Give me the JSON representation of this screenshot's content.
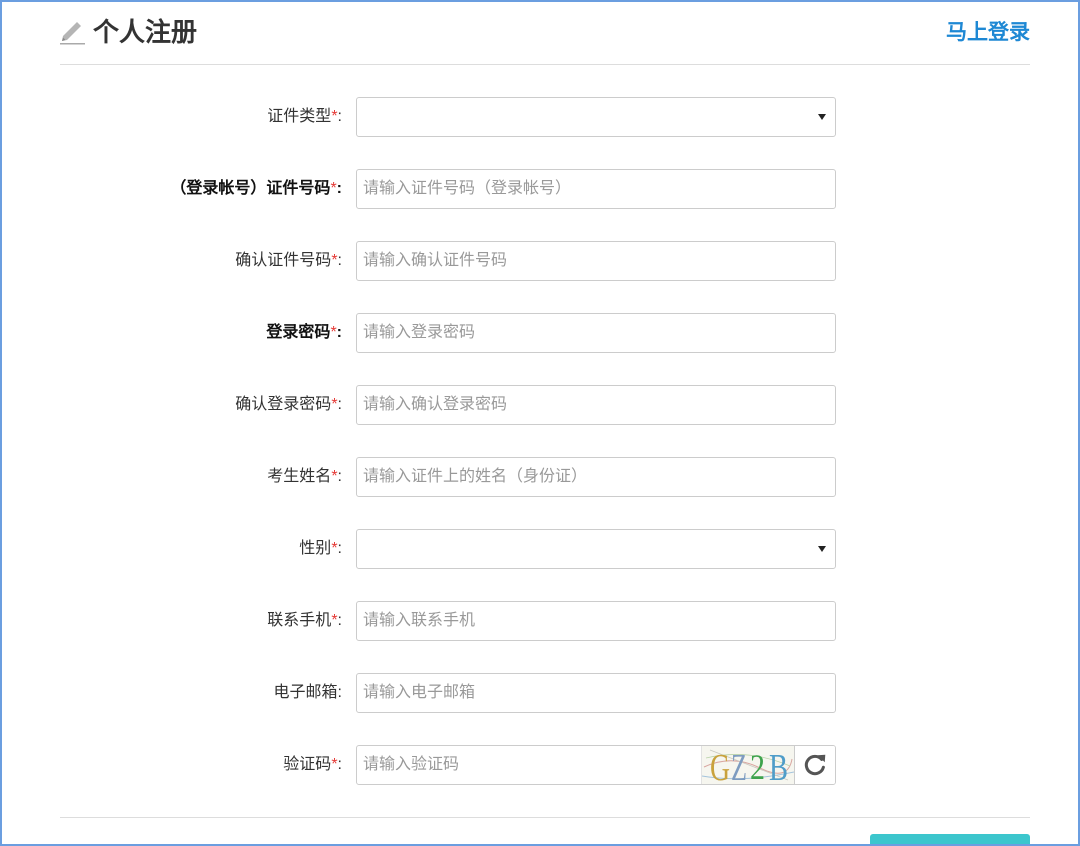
{
  "header": {
    "title": "个人注册",
    "login_link": "马上登录"
  },
  "form": {
    "colon": ":",
    "fields": [
      {
        "label": "证件类型",
        "required_mark": "*",
        "value": ""
      },
      {
        "label": "（登录帐号）证件号码",
        "required_mark": "*",
        "placeholder": "请输入证件号码（登录帐号）",
        "value": ""
      },
      {
        "label": "确认证件号码",
        "required_mark": "*",
        "placeholder": "请输入确认证件号码",
        "value": ""
      },
      {
        "label": "登录密码",
        "required_mark": "*",
        "placeholder": "请输入登录密码",
        "value": ""
      },
      {
        "label": "确认登录密码",
        "required_mark": "*",
        "placeholder": "请输入确认登录密码",
        "value": ""
      },
      {
        "label": "考生姓名",
        "required_mark": "*",
        "placeholder": "请输入证件上的姓名（身份证）",
        "value": ""
      },
      {
        "label": "性别",
        "required_mark": "*",
        "value": ""
      },
      {
        "label": "联系手机",
        "required_mark": "*",
        "placeholder": "请输入联系手机",
        "value": ""
      },
      {
        "label": "电子邮箱",
        "required_mark": "",
        "placeholder": "请输入电子邮箱",
        "value": ""
      },
      {
        "label": "验证码",
        "required_mark": "*",
        "placeholder": "请输入验证码",
        "value": ""
      }
    ]
  },
  "captcha": {
    "chars": [
      {
        "char": "G",
        "color": "#c9a23c"
      },
      {
        "char": "Z",
        "color": "#7e9cc0"
      },
      {
        "char": "2",
        "color": "#3ea34c"
      },
      {
        "char": "B",
        "color": "#4f9dc9"
      }
    ]
  },
  "icons": {
    "title": "pencil-icon",
    "select": "caret-down-icon",
    "refresh": "refresh-icon"
  },
  "colors": {
    "accent": "#1e88d4",
    "required": "#e53935",
    "button": "#3cc6cd",
    "frame": "#6b9ee0",
    "label": "#333333",
    "placeholder": "#999999",
    "border": "#cccccc"
  }
}
